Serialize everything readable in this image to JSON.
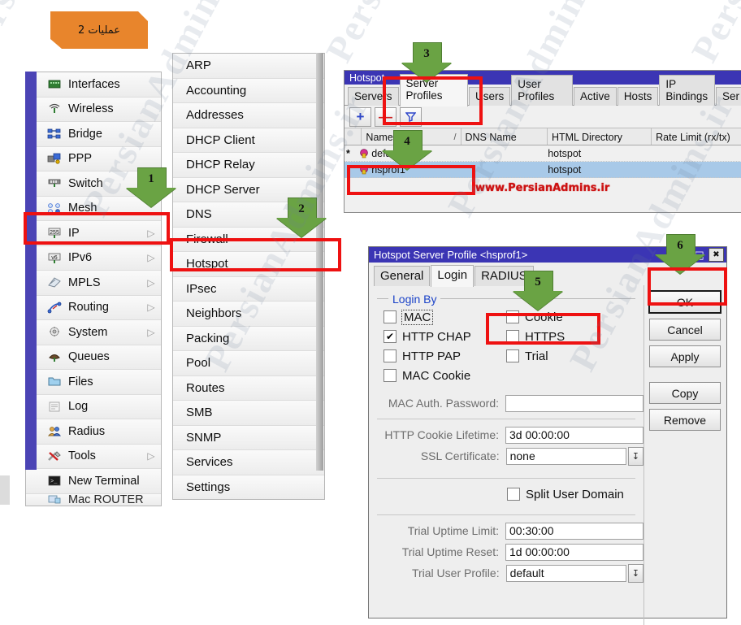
{
  "step_banner": {
    "label": "عملیات 2"
  },
  "watermark": {
    "red_text": "www.PersianAdmins.ir",
    "wash_text": "PersianAdmins.ir"
  },
  "main_menu": {
    "items": [
      {
        "label": "Interfaces",
        "icon": "interfaces-icon",
        "submenu": false
      },
      {
        "label": "Wireless",
        "icon": "wireless-icon",
        "submenu": false
      },
      {
        "label": "Bridge",
        "icon": "bridge-icon",
        "submenu": false
      },
      {
        "label": "PPP",
        "icon": "ppp-icon",
        "submenu": false
      },
      {
        "label": "Switch",
        "icon": "switch-icon",
        "submenu": false
      },
      {
        "label": "Mesh",
        "icon": "mesh-icon",
        "submenu": false
      },
      {
        "label": "IP",
        "icon": "ip-icon",
        "submenu": true
      },
      {
        "label": "IPv6",
        "icon": "ipv6-icon",
        "submenu": true
      },
      {
        "label": "MPLS",
        "icon": "mpls-icon",
        "submenu": true
      },
      {
        "label": "Routing",
        "icon": "routing-icon",
        "submenu": true
      },
      {
        "label": "System",
        "icon": "system-icon",
        "submenu": true
      },
      {
        "label": "Queues",
        "icon": "queues-icon",
        "submenu": false
      },
      {
        "label": "Files",
        "icon": "files-icon",
        "submenu": false
      },
      {
        "label": "Log",
        "icon": "log-icon",
        "submenu": false
      },
      {
        "label": "Radius",
        "icon": "radius-icon",
        "submenu": false
      },
      {
        "label": "Tools",
        "icon": "tools-icon",
        "submenu": true
      },
      {
        "label": "New Terminal",
        "icon": "terminal-icon",
        "submenu": false
      },
      {
        "label": "Mac ROUTER",
        "icon": "mac-router-icon",
        "submenu": false
      }
    ],
    "submenu_arrow": "▷"
  },
  "ip_menu": {
    "items": [
      {
        "label": "ARP"
      },
      {
        "label": "Accounting"
      },
      {
        "label": "Addresses"
      },
      {
        "label": "DHCP Client"
      },
      {
        "label": "DHCP Relay"
      },
      {
        "label": "DHCP Server"
      },
      {
        "label": "DNS"
      },
      {
        "label": "Firewall"
      },
      {
        "label": "Hotspot"
      },
      {
        "label": "IPsec"
      },
      {
        "label": "Neighbors"
      },
      {
        "label": "Packing"
      },
      {
        "label": "Pool"
      },
      {
        "label": "Routes"
      },
      {
        "label": "SMB"
      },
      {
        "label": "SNMP"
      },
      {
        "label": "Services"
      },
      {
        "label": "Settings"
      }
    ]
  },
  "hotspot_window": {
    "title": "Hotspot",
    "tabs": [
      {
        "label": "Servers",
        "selected": false
      },
      {
        "label": "Server Profiles",
        "selected": true
      },
      {
        "label": "Users",
        "selected": false
      },
      {
        "label": "User Profiles",
        "selected": false
      },
      {
        "label": "Active",
        "selected": false
      },
      {
        "label": "Hosts",
        "selected": false
      },
      {
        "label": "IP Bindings",
        "selected": false
      },
      {
        "label": "Ser",
        "selected": false
      }
    ],
    "toolbar": {
      "add_label": "+",
      "remove_label": "—",
      "filter_label": "filter-icon"
    },
    "columns": [
      "Name",
      "DNS Name",
      "HTML Directory",
      "Rate Limit (rx/tx)"
    ],
    "sort_indicator": "/",
    "rows": [
      {
        "flag": "*",
        "name": "default",
        "dns_name": "",
        "html_directory": "hotspot",
        "rate_limit": "",
        "selected": false
      },
      {
        "flag": "",
        "name": "hsprof1",
        "dns_name": "",
        "html_directory": "hotspot",
        "rate_limit": "",
        "selected": true
      }
    ]
  },
  "profile_dialog": {
    "title": "Hotspot Server Profile <hsprof1>",
    "title_buttons": {
      "maximize": "◱",
      "close": "✖"
    },
    "tabs": [
      {
        "label": "General",
        "selected": false
      },
      {
        "label": "Login",
        "selected": true
      },
      {
        "label": "RADIUS",
        "selected": false
      }
    ],
    "login_by": {
      "group_label": "Login By",
      "checkboxes": [
        {
          "label": "MAC",
          "checked": false,
          "focused": true
        },
        {
          "label": "Cookie",
          "checked": false,
          "focused": false
        },
        {
          "label": "HTTP CHAP",
          "checked": true,
          "focused": false
        },
        {
          "label": "HTTPS",
          "checked": false,
          "focused": false
        },
        {
          "label": "HTTP PAP",
          "checked": false,
          "focused": false
        },
        {
          "label": "Trial",
          "checked": false,
          "focused": false
        },
        {
          "label": "MAC Cookie",
          "checked": false,
          "focused": false
        }
      ],
      "check_glyph": "✔"
    },
    "fields": [
      {
        "label": "MAC Auth. Password:",
        "value": "",
        "dropdown": false
      },
      {
        "label": "HTTP Cookie Lifetime:",
        "value": "3d 00:00:00",
        "dropdown": false
      },
      {
        "label": "SSL Certificate:",
        "value": "none",
        "dropdown": true
      },
      {
        "label": "Trial Uptime Limit:",
        "value": "00:30:00",
        "dropdown": false
      },
      {
        "label": "Trial Uptime Reset:",
        "value": "1d 00:00:00",
        "dropdown": false
      },
      {
        "label": "Trial User Profile:",
        "value": "default",
        "dropdown": true
      }
    ],
    "split_user_domain": {
      "label": "Split User Domain",
      "checked": false
    },
    "dropdown_glyph": "↧",
    "buttons": [
      {
        "label": "OK",
        "primary": true
      },
      {
        "label": "Cancel",
        "primary": false
      },
      {
        "label": "Apply",
        "primary": false
      },
      {
        "label": "Copy",
        "primary": false
      },
      {
        "label": "Remove",
        "primary": false
      }
    ]
  },
  "callouts": [
    {
      "number": "1"
    },
    {
      "number": "2"
    },
    {
      "number": "3"
    },
    {
      "number": "4"
    },
    {
      "number": "5"
    },
    {
      "number": "6"
    }
  ],
  "colors": {
    "accent_blue": "#3b35b4",
    "highlight_red": "#ee1111",
    "arrow_green": "#6aa344",
    "banner_orange": "#e8852c",
    "row_select": "#a8c9e8"
  }
}
